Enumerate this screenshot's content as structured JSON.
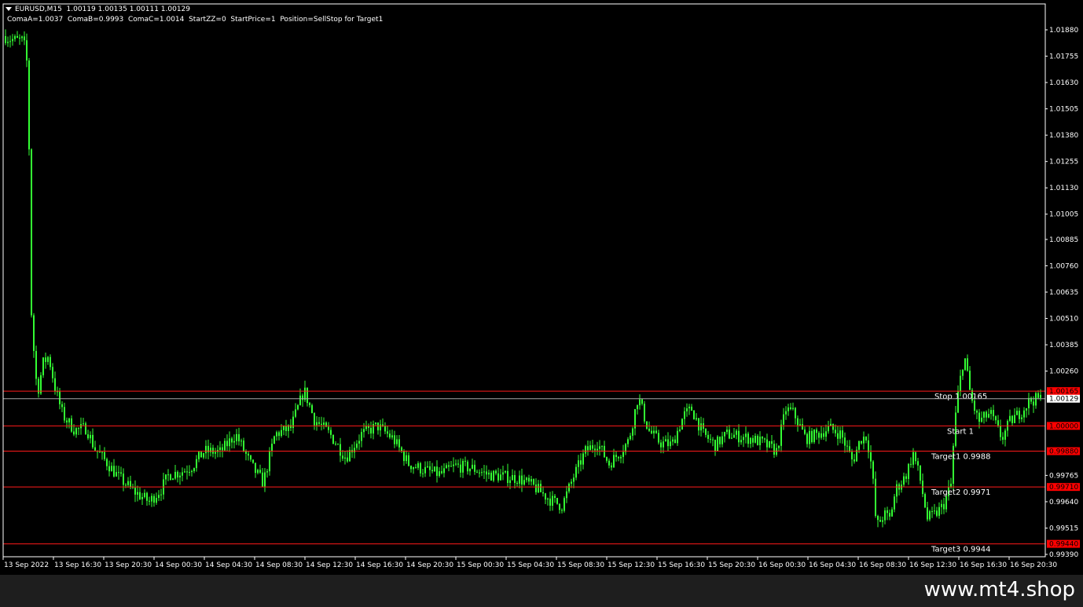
{
  "header": {
    "symbol_line": "EURUSD,M15  1.00119 1.00135 1.00111 1.00129",
    "params_line": "ComaA=1.0037  ComaB=0.9993  ComaC=1.0014  StartZZ=0  StartPrice=1  Position=SellStop for Target1"
  },
  "chart_data": {
    "type": "candlestick",
    "ylim": [
      0.9933,
      1.0195
    ],
    "price_ticks": [
      "1.01880",
      "1.01755",
      "1.01630",
      "1.01505",
      "1.01380",
      "1.01255",
      "1.01130",
      "1.01005",
      "1.00885",
      "1.00760",
      "1.00635",
      "1.00510",
      "1.00385",
      "1.00260",
      "0.99765",
      "0.99640",
      "0.99515",
      "0.99390"
    ],
    "time_ticks": [
      "13 Sep 2022",
      "13 Sep 16:30",
      "13 Sep 20:30",
      "14 Sep 00:30",
      "14 Sep 04:30",
      "14 Sep 08:30",
      "14 Sep 12:30",
      "14 Sep 16:30",
      "14 Sep 20:30",
      "15 Sep 00:30",
      "15 Sep 04:30",
      "15 Sep 08:30",
      "15 Sep 12:30",
      "15 Sep 16:30",
      "15 Sep 20:30",
      "16 Sep 00:30",
      "16 Sep 04:30",
      "16 Sep 08:30",
      "16 Sep 12:30",
      "16 Sep 16:30",
      "16 Sep 20:30"
    ],
    "current_price": "1.00129",
    "levels": [
      {
        "name": "stop",
        "price": 1.00165,
        "label": "1.00165",
        "text": "Stop 1.00165"
      },
      {
        "name": "start",
        "price": 1.0,
        "label": "1.00000",
        "text": "Start 1"
      },
      {
        "name": "target1",
        "price": 0.9988,
        "label": "0.99880",
        "text": "Target1 0.9988"
      },
      {
        "name": "target2",
        "price": 0.9971,
        "label": "0.99710",
        "text": "Target2 0.9971"
      },
      {
        "name": "target3",
        "price": 0.9944,
        "label": "0.99440",
        "text": "Target3 0.9944"
      }
    ],
    "close_path": [
      [
        0,
        1.017
      ],
      [
        6,
        1.0185
      ],
      [
        10,
        1.0184
      ],
      [
        20,
        1.0183
      ],
      [
        30,
        1.0183
      ],
      [
        36,
        1.0168
      ],
      [
        39,
        1.006
      ],
      [
        41,
        1.0047
      ],
      [
        45,
        1.0025
      ],
      [
        48,
        1.0016
      ],
      [
        55,
        1.003
      ],
      [
        62,
        1.0033
      ],
      [
        70,
        1.0018
      ],
      [
        80,
        1.0005
      ],
      [
        95,
        0.9998
      ],
      [
        110,
        0.9999
      ],
      [
        120,
        0.99895
      ],
      [
        135,
        0.9983
      ],
      [
        150,
        0.9976
      ],
      [
        170,
        0.9969
      ],
      [
        190,
        0.9964
      ],
      [
        205,
        0.997
      ],
      [
        215,
        0.9977
      ],
      [
        230,
        0.9978
      ],
      [
        245,
        0.9981
      ],
      [
        260,
        0.9988
      ],
      [
        280,
        0.99875
      ],
      [
        300,
        0.9996
      ],
      [
        320,
        0.9981
      ],
      [
        335,
        0.9973
      ],
      [
        350,
        0.9996
      ],
      [
        370,
        0.9999
      ],
      [
        387,
        1.0017
      ],
      [
        400,
        1.0003
      ],
      [
        420,
        0.9996
      ],
      [
        440,
        0.9985
      ],
      [
        460,
        0.9996
      ],
      [
        480,
        1.0
      ],
      [
        500,
        0.9994
      ],
      [
        520,
        0.9982
      ],
      [
        540,
        0.9979
      ],
      [
        560,
        0.9977
      ],
      [
        580,
        0.9981
      ],
      [
        600,
        0.998
      ],
      [
        620,
        0.9977
      ],
      [
        640,
        0.9976
      ],
      [
        660,
        0.9975
      ],
      [
        680,
        0.9971
      ],
      [
        700,
        0.9965
      ],
      [
        715,
        0.9962
      ],
      [
        730,
        0.9976
      ],
      [
        745,
        0.9988
      ],
      [
        760,
        0.9992
      ],
      [
        775,
        0.9982
      ],
      [
        790,
        0.9988
      ],
      [
        800,
        0.9993
      ],
      [
        812,
        1.0014
      ],
      [
        825,
        0.9998
      ],
      [
        840,
        0.9992
      ],
      [
        855,
        0.9991
      ],
      [
        870,
        1.0005
      ],
      [
        880,
        1.0008
      ],
      [
        895,
        0.9996
      ],
      [
        910,
        0.9991
      ],
      [
        925,
        0.9996
      ],
      [
        940,
        0.9995
      ],
      [
        955,
        0.9994
      ],
      [
        970,
        0.9992
      ],
      [
        988,
        0.9988
      ],
      [
        1000,
        1.0008
      ],
      [
        1010,
        1.0006
      ],
      [
        1025,
        0.9994
      ],
      [
        1040,
        0.9996
      ],
      [
        1055,
        0.9999
      ],
      [
        1070,
        0.9996
      ],
      [
        1085,
        0.9983
      ],
      [
        1095,
        0.9994
      ],
      [
        1103,
        0.9995
      ],
      [
        1110,
        0.9978
      ],
      [
        1115,
        0.9952
      ],
      [
        1125,
        0.9958
      ],
      [
        1132,
        0.9956
      ],
      [
        1140,
        0.997
      ],
      [
        1152,
        0.9976
      ],
      [
        1162,
        0.9987
      ],
      [
        1170,
        0.9976
      ],
      [
        1180,
        0.9956
      ],
      [
        1190,
        0.9958
      ],
      [
        1200,
        0.9962
      ],
      [
        1210,
        0.9972
      ],
      [
        1215,
        1.0002
      ],
      [
        1220,
        1.0018
      ],
      [
        1227,
        1.0034
      ],
      [
        1235,
        1.0014
      ],
      [
        1245,
        1.0002
      ],
      [
        1260,
        1.0006
      ],
      [
        1275,
        0.9994
      ],
      [
        1285,
        1.0002
      ],
      [
        1300,
        1.0007
      ],
      [
        1310,
        1.0012
      ],
      [
        1322,
        1.00129
      ]
    ]
  },
  "footer": {
    "watermark": "www.mt4.shop"
  },
  "colors": {
    "candle": "#33ff33",
    "level_line": "#ff1a1a",
    "level_label_bg": "#ff0000",
    "current_price_line": "#a8a8a8",
    "axis": "#ffffff"
  }
}
